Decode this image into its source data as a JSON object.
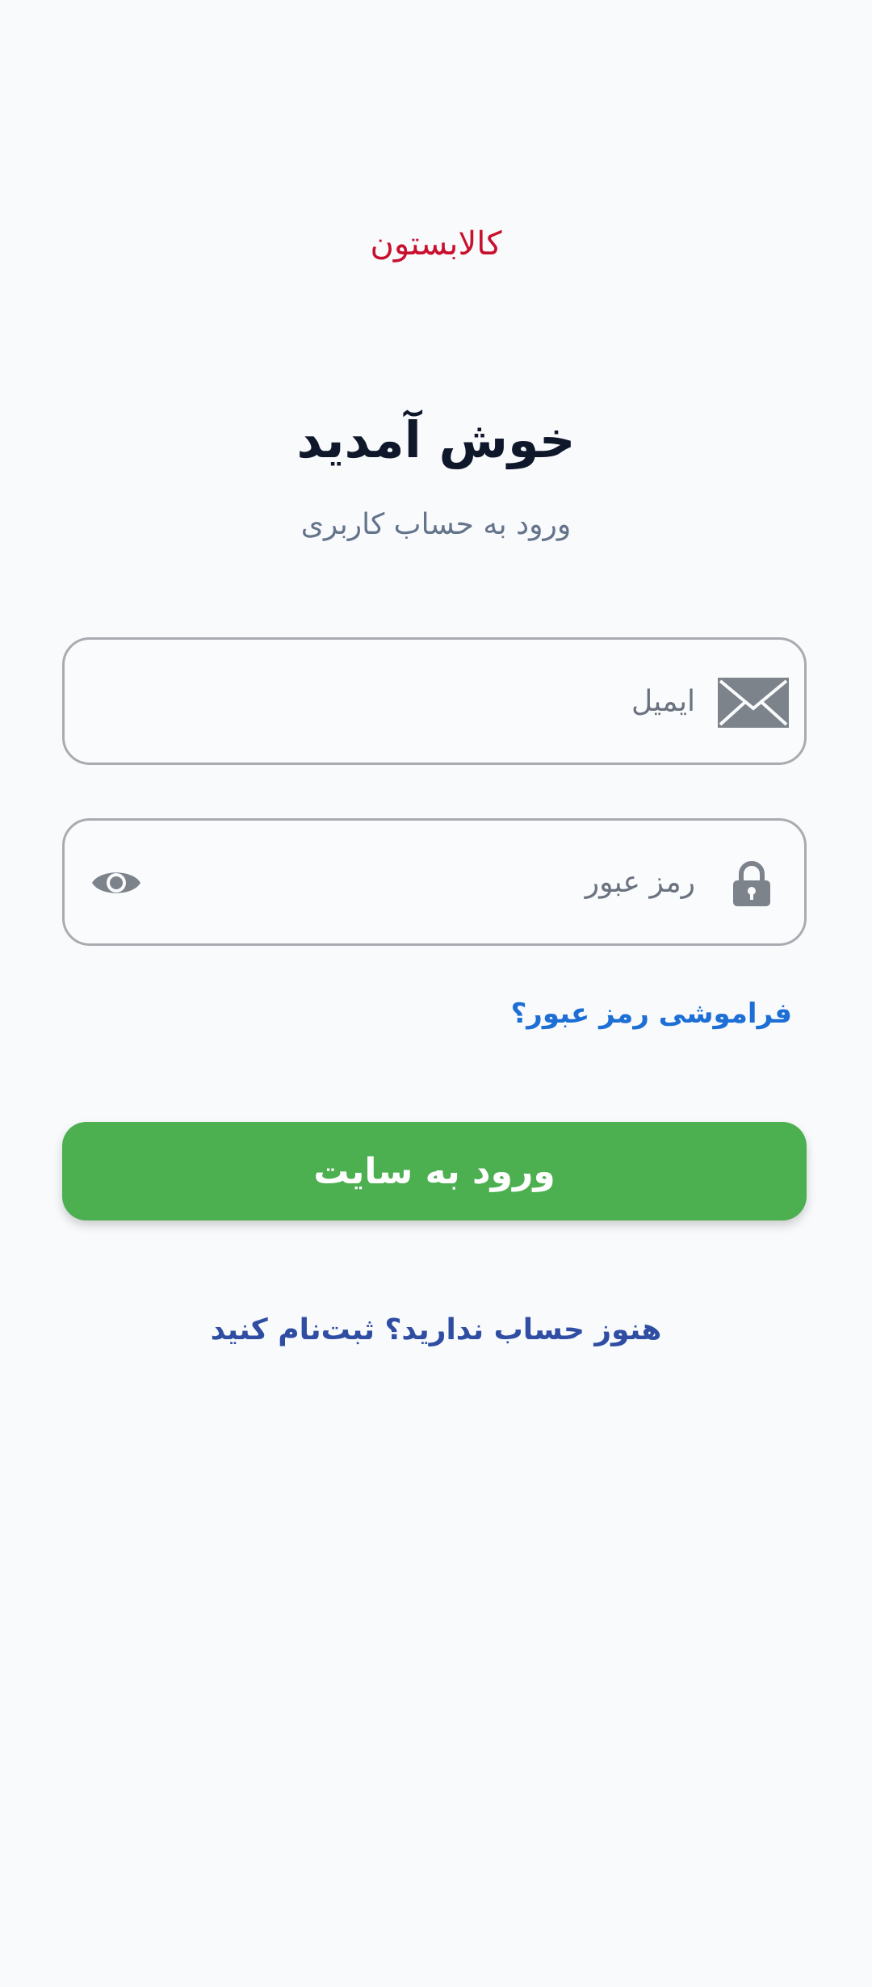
{
  "brand": {
    "logo_text": "کالابستون",
    "logo_color": "#c8102e"
  },
  "header": {
    "title": "خوش آمدید",
    "subtitle": "ورود به حساب کاربری"
  },
  "form": {
    "email": {
      "placeholder": "ایمیل",
      "value": "",
      "icon": "mail-icon"
    },
    "password": {
      "placeholder": "رمز عبور",
      "value": "",
      "icon": "lock-icon",
      "toggle_icon": "eye-icon"
    },
    "forgot_label": "فراموشی رمز عبور؟",
    "submit_label": "ورود به سایت"
  },
  "footer": {
    "signup_label": "هنوز حساب ندارید؟ ثبت‌نام کنید"
  },
  "colors": {
    "background": "#f9fafc",
    "primary_button": "#4caf50",
    "link": "#1d6fd6",
    "signup_link": "#2f4ea3",
    "input_border": "#a8abb0",
    "icon": "#7d838b"
  }
}
